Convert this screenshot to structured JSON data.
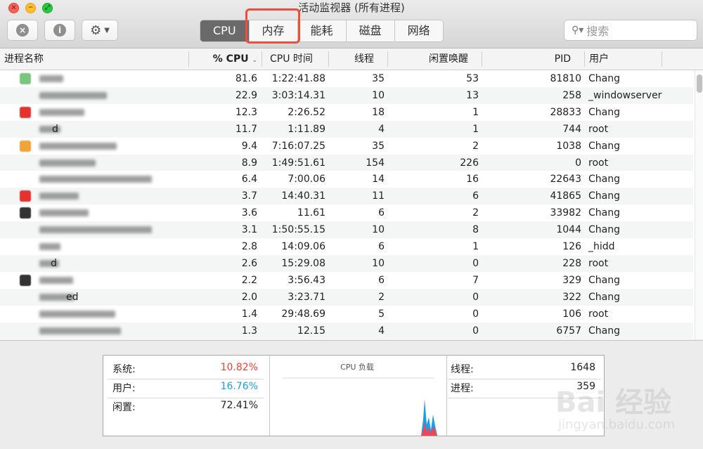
{
  "window": {
    "title": "活动监视器 (所有进程)"
  },
  "toolbar": {
    "tabs": [
      "CPU",
      "内存",
      "能耗",
      "磁盘",
      "网络"
    ],
    "active_tab": "CPU",
    "search_placeholder": "搜索"
  },
  "columns": {
    "name": "进程名称",
    "cpu": "% CPU",
    "cpu_time": "CPU 时间",
    "threads": "线程",
    "idle_wakeups": "闲置唤醒",
    "pid": "PID",
    "user": "用户"
  },
  "rows": [
    {
      "name_visible": "",
      "cpu": "81.6",
      "time": "1:22:41.88",
      "threads": "35",
      "idle": "53",
      "pid": "81810",
      "user": "Chang"
    },
    {
      "name_visible": "",
      "cpu": "22.9",
      "time": "3:03:14.31",
      "threads": "10",
      "idle": "13",
      "pid": "258",
      "user": "_windowserver"
    },
    {
      "name_visible": "",
      "cpu": "12.3",
      "time": "2:26.52",
      "threads": "18",
      "idle": "1",
      "pid": "28833",
      "user": "Chang"
    },
    {
      "name_visible": "d",
      "cpu": "11.7",
      "time": "1:11.89",
      "threads": "4",
      "idle": "1",
      "pid": "744",
      "user": "root"
    },
    {
      "name_visible": "",
      "cpu": "9.4",
      "time": "7:16:07.25",
      "threads": "35",
      "idle": "2",
      "pid": "1038",
      "user": "Chang"
    },
    {
      "name_visible": "",
      "cpu": "8.9",
      "time": "1:49:51.61",
      "threads": "154",
      "idle": "226",
      "pid": "0",
      "user": "root"
    },
    {
      "name_visible": "",
      "cpu": "6.4",
      "time": "7:00.06",
      "threads": "14",
      "idle": "16",
      "pid": "22643",
      "user": "Chang"
    },
    {
      "name_visible": "",
      "cpu": "3.7",
      "time": "14:40.31",
      "threads": "11",
      "idle": "6",
      "pid": "41865",
      "user": "Chang"
    },
    {
      "name_visible": "",
      "cpu": "3.6",
      "time": "11.61",
      "threads": "6",
      "idle": "2",
      "pid": "33982",
      "user": "Chang"
    },
    {
      "name_visible": "",
      "cpu": "3.1",
      "time": "1:50:55.15",
      "threads": "10",
      "idle": "8",
      "pid": "1044",
      "user": "Chang"
    },
    {
      "name_visible": "",
      "cpu": "2.8",
      "time": "14:09.06",
      "threads": "6",
      "idle": "1",
      "pid": "126",
      "user": "_hidd"
    },
    {
      "name_visible": "d",
      "cpu": "2.6",
      "time": "15:29.08",
      "threads": "10",
      "idle": "0",
      "pid": "228",
      "user": "root"
    },
    {
      "name_visible": "",
      "cpu": "2.2",
      "time": "3:56.43",
      "threads": "6",
      "idle": "7",
      "pid": "329",
      "user": "Chang"
    },
    {
      "name_visible": "ed",
      "cpu": "2.0",
      "time": "3:23.71",
      "threads": "2",
      "idle": "0",
      "pid": "322",
      "user": "Chang"
    },
    {
      "name_visible": "",
      "cpu": "1.4",
      "time": "29:48.69",
      "threads": "5",
      "idle": "0",
      "pid": "106",
      "user": "root"
    },
    {
      "name_visible": "",
      "cpu": "1.3",
      "time": "12.15",
      "threads": "4",
      "idle": "0",
      "pid": "6757",
      "user": "Chang"
    }
  ],
  "summary": {
    "system_label": "系统:",
    "system_value": "10.82%",
    "user_label": "用户:",
    "user_value": "16.76%",
    "idle_label": "闲置:",
    "idle_value": "72.41%",
    "chart_title": "CPU 负载",
    "threads_label": "线程:",
    "threads_value": "1648",
    "processes_label": "进程:",
    "processes_value": "359"
  },
  "colors": {
    "system": "#ff3b30",
    "user": "#1aa0e8",
    "active_tab": "#6a6a6a",
    "highlight": "#ef4d3e"
  },
  "icons": [
    "close-icon",
    "minimize-icon",
    "zoom-icon",
    "stop-process-icon",
    "info-icon",
    "gear-icon",
    "chevron-down-icon",
    "search-icon"
  ],
  "watermark": {
    "text": "Bai 经验",
    "url_text": "jingyan.baidu.com"
  }
}
